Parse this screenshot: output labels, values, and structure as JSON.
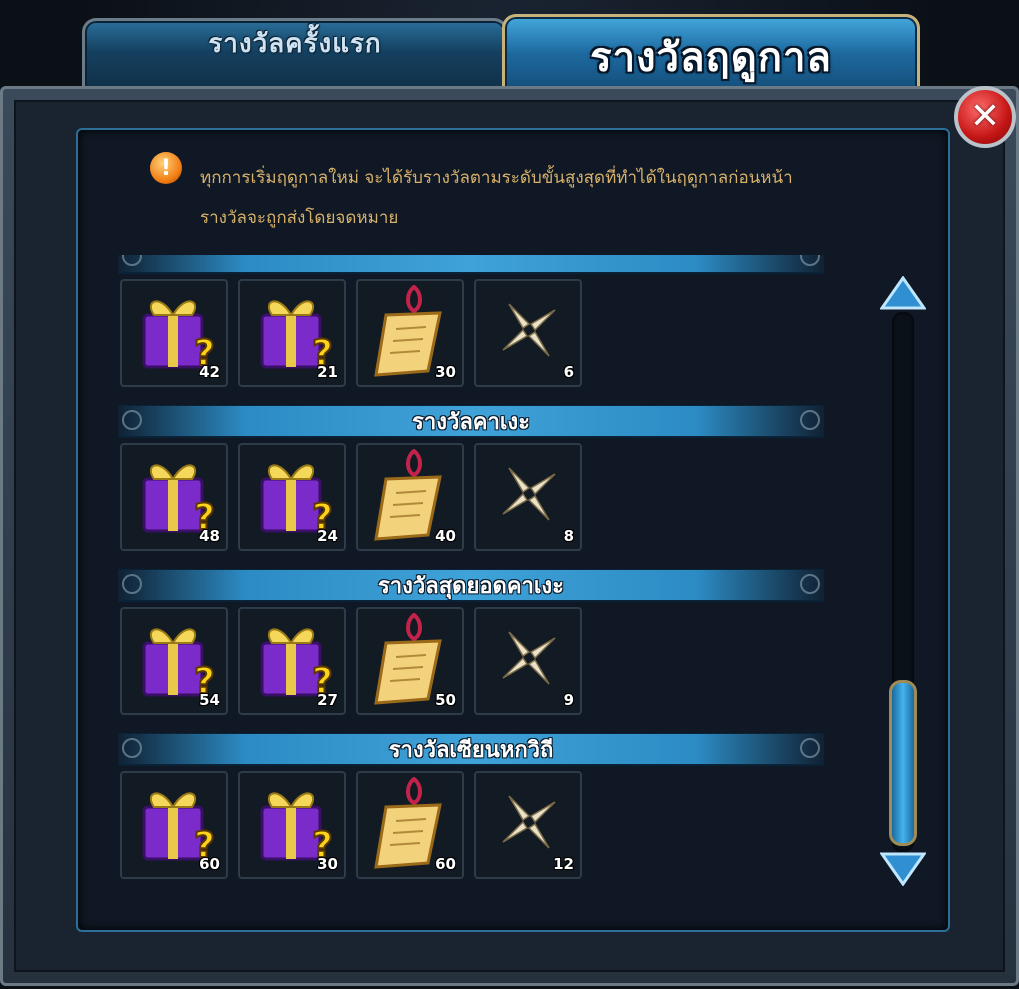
{
  "tabs": [
    {
      "label": "รางวัลครั้งแรก",
      "active": false
    },
    {
      "label": "รางวัลฤดูกาล",
      "active": true
    }
  ],
  "notice": {
    "icon": "exclamation-icon",
    "line1": "ทุกการเริ่มฤดูกาลใหม่ จะได้รับรางวัลตามระดับขั้นสูงสุดที่ทำได้ในฤดูกาลก่อนหน้า",
    "line2": "รางวัลจะถูกส่งโดยจดหมาย"
  },
  "tiers": [
    {
      "name": "",
      "rewards": [
        {
          "icon": "purple-gift-box-icon",
          "qty": "42"
        },
        {
          "icon": "purple-gift-box-icon",
          "qty": "21"
        },
        {
          "icon": "scroll-icon",
          "qty": "30"
        },
        {
          "icon": "shuriken-icon",
          "qty": "6"
        }
      ]
    },
    {
      "name": "รางวัลคาเงะ",
      "rewards": [
        {
          "icon": "purple-gift-box-icon",
          "qty": "48"
        },
        {
          "icon": "purple-gift-box-icon",
          "qty": "24"
        },
        {
          "icon": "scroll-icon",
          "qty": "40"
        },
        {
          "icon": "shuriken-icon",
          "qty": "8"
        }
      ]
    },
    {
      "name": "รางวัลสุดยอดคาเงะ",
      "rewards": [
        {
          "icon": "purple-gift-box-icon",
          "qty": "54"
        },
        {
          "icon": "purple-gift-box-icon",
          "qty": "27"
        },
        {
          "icon": "scroll-icon",
          "qty": "50"
        },
        {
          "icon": "shuriken-icon",
          "qty": "9"
        }
      ]
    },
    {
      "name": "รางวัลเซียนหกวิถี",
      "rewards": [
        {
          "icon": "purple-gift-box-icon",
          "qty": "60"
        },
        {
          "icon": "purple-gift-box-icon",
          "qty": "30"
        },
        {
          "icon": "scroll-icon",
          "qty": "60"
        },
        {
          "icon": "shuriken-icon",
          "qty": "12"
        }
      ]
    }
  ],
  "colors": {
    "accent_blue": "#3fa2d8",
    "notice_text": "#d8b26a",
    "close_red": "#c41515"
  }
}
